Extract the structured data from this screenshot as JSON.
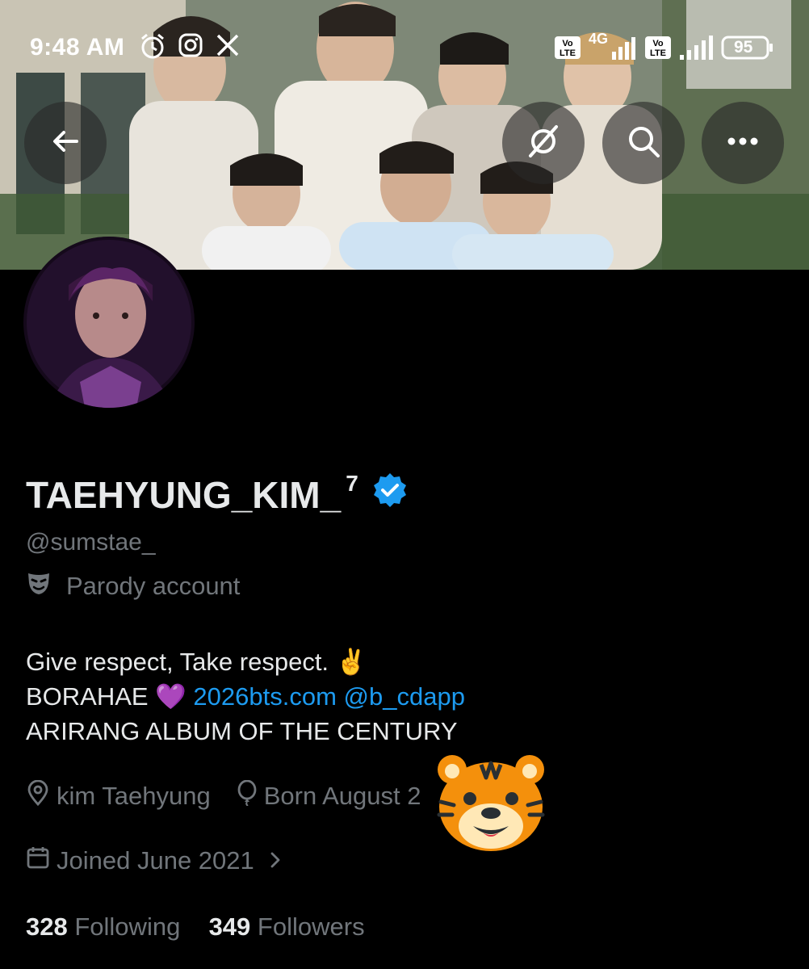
{
  "status_bar": {
    "time": "9:48 AM",
    "network_label": "4G",
    "volte_label_1": "Vo\nLTE",
    "volte_label_2": "Vo\nLTE",
    "battery_level": "95",
    "icons": [
      "alarm-icon",
      "instagram-icon",
      "x-logo-icon",
      "volte-icon",
      "signal-icon",
      "battery-icon"
    ]
  },
  "header_buttons": {
    "back": "back-arrow-icon",
    "grok": "grok-icon",
    "search": "search-icon",
    "more": "more-icon"
  },
  "profile": {
    "display_name": "TAEHYUNG_KIM_",
    "name_superscript": "7",
    "verified": true,
    "handle": "@sumstae_",
    "parody_label": "Parody account",
    "bio_line1": "Give respect, Take respect. ✌️",
    "bio_line2_text": "BORAHAE 💜 ",
    "bio_link1": "2026bts.com",
    "bio_link2": "@b_cdapp",
    "bio_line3": "ARIRANG ALBUM OF THE CENTURY",
    "location": "kim Taehyung",
    "birthday": "Born August 2",
    "joined": "Joined June 2021",
    "following_count": "328",
    "following_label": "Following",
    "followers_count": "349",
    "followers_label": "Followers"
  },
  "colors": {
    "background": "#000000",
    "text_primary": "#e7e9ea",
    "text_secondary": "#71767b",
    "link": "#1d9bf0",
    "verified_badge": "#1d9bf0"
  }
}
